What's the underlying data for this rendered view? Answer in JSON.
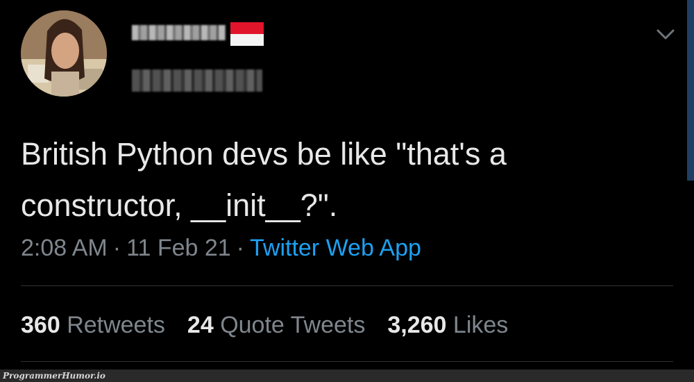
{
  "tweet": {
    "text": "British Python devs be like \"that's a\nconstructor, __init__?\".",
    "time": "2:08 AM",
    "date": "11 Feb 21",
    "source": "Twitter Web App",
    "separator": "·"
  },
  "stats": {
    "retweets_count": "360",
    "retweets_label": "Retweets",
    "quotes_count": "24",
    "quotes_label": "Quote Tweets",
    "likes_count": "3,260",
    "likes_label": "Likes"
  },
  "watermark": "ProgrammerHumor.io",
  "colors": {
    "background": "#000000",
    "text": "#e8e8e8",
    "muted": "#7f868d",
    "link": "#1da1f2"
  },
  "icons": {
    "caret": "chevron-down-icon",
    "flag": "indonesia-flag-icon"
  }
}
